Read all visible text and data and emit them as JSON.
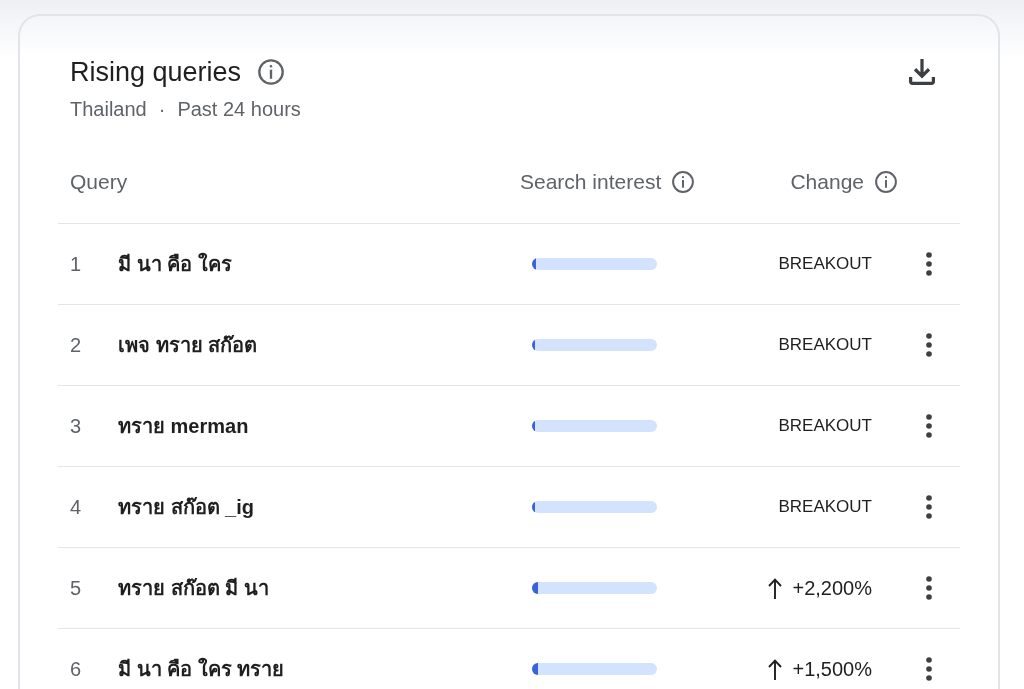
{
  "card": {
    "title": "Rising queries",
    "subtitle": {
      "location": "Thailand",
      "separator": "·",
      "period": "Past 24 hours"
    }
  },
  "table": {
    "columns": [
      {
        "label": "Query",
        "info": false
      },
      {
        "label": "Search interest",
        "info": true
      },
      {
        "label": "Change",
        "info": true
      }
    ],
    "rows": [
      {
        "rank": "1",
        "query": "มี นา คือ ใคร",
        "level": 0.03,
        "kind": "breakout",
        "change": "BREAKOUT"
      },
      {
        "rank": "2",
        "query": "เพจ ทราย สก๊อต",
        "level": 0.02,
        "kind": "breakout",
        "change": "BREAKOUT"
      },
      {
        "rank": "3",
        "query": "ทราย merman",
        "level": 0.02,
        "kind": "breakout",
        "change": "BREAKOUT"
      },
      {
        "rank": "4",
        "query": "ทราย สก๊อต _ig",
        "level": 0.02,
        "kind": "breakout",
        "change": "BREAKOUT"
      },
      {
        "rank": "5",
        "query": "ทราย สก๊อต มี นา",
        "level": 0.05,
        "kind": "increase",
        "change": "+2,200%"
      },
      {
        "rank": "6",
        "query": "มี นา คือ ใคร ทราย",
        "level": 0.05,
        "kind": "increase",
        "change": "+1,500%"
      }
    ]
  }
}
